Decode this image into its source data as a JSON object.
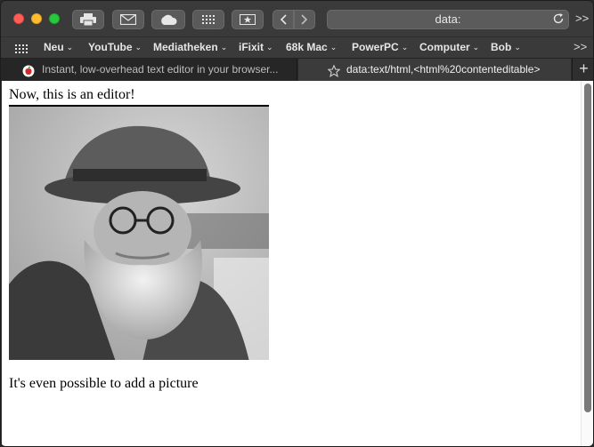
{
  "browser": {
    "address": "data:",
    "toolbar_more": ">>"
  },
  "bookmarks": {
    "items": [
      {
        "label": "Neu"
      },
      {
        "label": "YouTube"
      },
      {
        "label": "Mediatheken"
      },
      {
        "label": "iFixit"
      },
      {
        "label": "68k Mac"
      },
      {
        "label": "PowerPC"
      },
      {
        "label": "Computer"
      },
      {
        "label": "Bob"
      }
    ],
    "more": ">>"
  },
  "tabs": [
    {
      "title": "Instant, low-overhead text editor in your browser..."
    },
    {
      "title": "data:text/html,<html%20contenteditable>"
    }
  ],
  "tab_add": "+",
  "page": {
    "heading_text": "Now, this is an editor!",
    "caption_text": "It's even possible to add a picture"
  }
}
